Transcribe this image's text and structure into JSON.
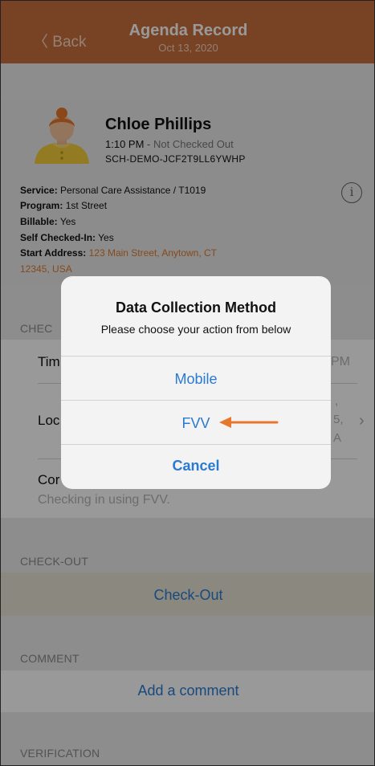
{
  "nav": {
    "back_label": "〈 Back",
    "title": "Agenda Record",
    "date": "Oct 13, 2020"
  },
  "client": {
    "name": "Chloe Phillips",
    "time": "1:10 PM",
    "separator": " - ",
    "status": "Not Checked Out",
    "code": "SCH-DEMO-JCF2T9LL6YWHP"
  },
  "details": {
    "service_label": "Service:",
    "service_value": "Personal Care Assistance / T1019",
    "program_label": "Program:",
    "program_value": "1st Street",
    "billable_label": "Billable:",
    "billable_value": "Yes",
    "self_checked_label": "Self Checked-In:",
    "self_checked_value": "Yes",
    "start_address_label": "Start Address:",
    "start_address_line1": "123 Main Street, Anytown, CT",
    "start_address_line2": "12345, USA"
  },
  "checkin": {
    "header": "CHEC",
    "time_label": "Tim",
    "time_value": "PM",
    "location_label": "Loc",
    "location_value_line1": ",",
    "location_value_line2": "5,",
    "location_value_line3": "A",
    "comment_label": "Cor",
    "comment_value": "Checking in using FVV."
  },
  "checkout": {
    "header": "CHECK-OUT",
    "button_label": "Check-Out"
  },
  "comment": {
    "header": "COMMENT",
    "button_label": "Add a comment"
  },
  "verification": {
    "header": "VERIFICATION"
  },
  "modal": {
    "title": "Data Collection Method",
    "subtitle": "Please choose your action from below",
    "options": [
      "Mobile",
      "FVV"
    ],
    "cancel_label": "Cancel"
  },
  "colors": {
    "nav_bg": "#c8703f",
    "accent_blue": "#2a7ad1",
    "address_orange": "#e07b2e",
    "arrow_orange": "#e8772e",
    "checkout_band": "#e8e3d5"
  },
  "icons": [
    "info-icon",
    "chevron-right-icon",
    "arrow-left-icon",
    "avatar"
  ]
}
